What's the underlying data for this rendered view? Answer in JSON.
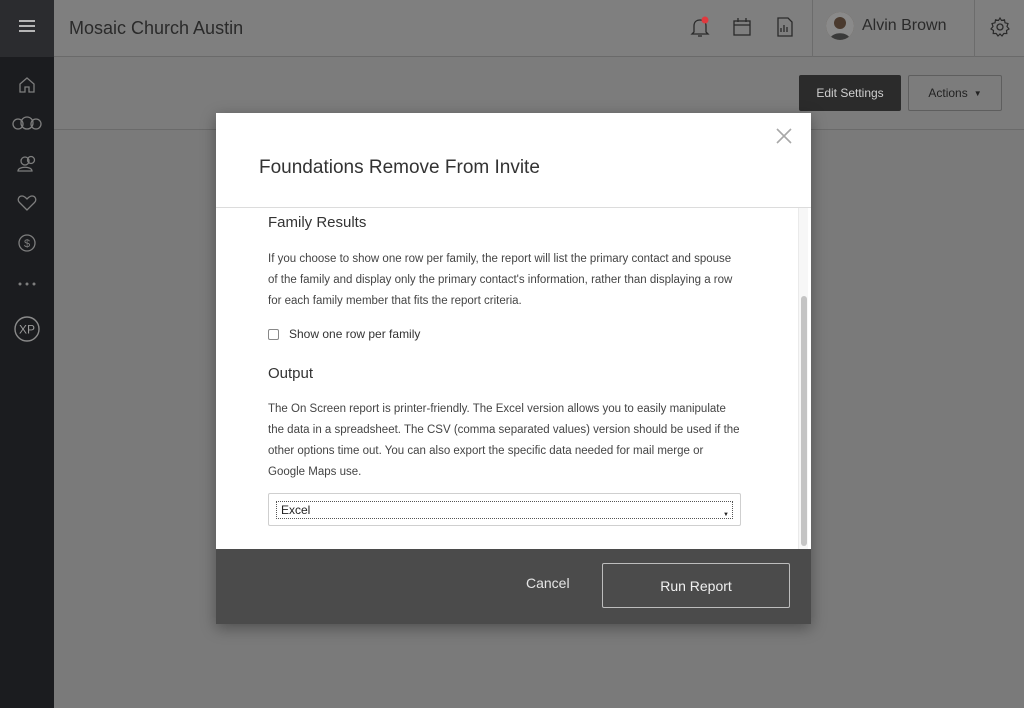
{
  "topbar": {
    "org_name": "Mosaic Church Austin",
    "user_name": "Alvin Brown",
    "icons": [
      "notification-bell-icon",
      "calendar-icon",
      "report-icon",
      "settings-gear-icon"
    ],
    "notification_color": "#e0393e"
  },
  "sidebar": {
    "items": [
      {
        "icon": "home-icon"
      },
      {
        "icon": "groups-icon"
      },
      {
        "icon": "people-icon"
      },
      {
        "icon": "heart-icon"
      },
      {
        "icon": "giving-dollar-icon"
      },
      {
        "icon": "more-icon"
      },
      {
        "icon": "xp-icon",
        "label": "XP"
      }
    ]
  },
  "subheader": {
    "edit_settings_label": "Edit Settings",
    "actions_label": "Actions"
  },
  "modal": {
    "title": "Foundations Remove From Invite",
    "family_results": {
      "heading": "Family Results",
      "description": "If you choose to show one row per family, the report will list the primary contact and spouse of the family and display only the primary contact's information, rather than displaying a row for each family member that fits the report criteria.",
      "checkbox_label": "Show one row per family",
      "checked": false
    },
    "output": {
      "heading": "Output",
      "description": "The On Screen report is printer-friendly. The Excel version allows you to easily manipulate the data in a spreadsheet. The CSV (comma separated values) version should be used if the other options time out. You can also export the specific data needed for mail merge or Google Maps use.",
      "selected_format": "Excel"
    },
    "cancel_label": "Cancel",
    "run_report_label": "Run Report"
  }
}
